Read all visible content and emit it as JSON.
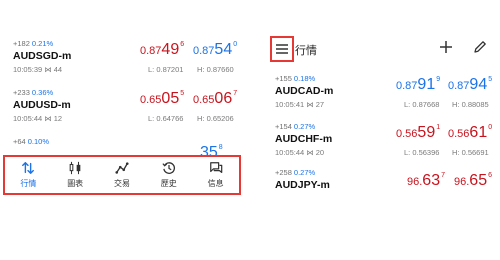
{
  "left": {
    "quotes": [
      {
        "change": "+182",
        "pct": "0.21%",
        "symbol": "AUDSGD-m",
        "time": "10:05:39",
        "spread": "44",
        "bid": {
          "small": "0.87",
          "big": "49",
          "sup": "6"
        },
        "ask": {
          "small": "0.87",
          "big": "54",
          "sup": "0"
        },
        "low": "L: 0.87201",
        "high": "H: 0.87660"
      },
      {
        "change": "+233",
        "pct": "0.36%",
        "symbol": "AUDUSD-m",
        "time": "10:05:44",
        "spread": "12",
        "bid": {
          "small": "0.65",
          "big": "05",
          "sup": "5"
        },
        "ask": {
          "small": "0.65",
          "big": "06",
          "sup": "7"
        },
        "low": "L: 0.64766",
        "high": "H: 0.65206"
      },
      {
        "change": "+64",
        "pct": "0.10%",
        "ask_partial": {
          "big": "35",
          "sup": "8"
        }
      }
    ],
    "bottom_nav": [
      {
        "label": "行情",
        "icon": "quotes-icon",
        "active": true
      },
      {
        "label": "圖表",
        "icon": "chart-icon",
        "active": false
      },
      {
        "label": "交易",
        "icon": "trade-icon",
        "active": false
      },
      {
        "label": "歷史",
        "icon": "history-icon",
        "active": false
      },
      {
        "label": "信息",
        "icon": "messages-icon",
        "active": false
      }
    ]
  },
  "right": {
    "header": {
      "title": "行情",
      "menu_icon": "hamburger-icon",
      "add_icon": "plus-icon",
      "edit_icon": "pencil-icon"
    },
    "quotes": [
      {
        "change": "+155",
        "pct": "0.18%",
        "symbol": "AUDCAD-m",
        "time": "10:05:41",
        "spread": "27",
        "bid": {
          "small": "0.87",
          "big": "91",
          "sup": "9",
          "color": "blue"
        },
        "ask": {
          "small": "0.87",
          "big": "94",
          "sup": "5",
          "color": "blue"
        },
        "low": "L: 0.87668",
        "high": "H: 0.88085"
      },
      {
        "change": "+154",
        "pct": "0.27%",
        "symbol": "AUDCHF-m",
        "time": "10:05:44",
        "spread": "20",
        "bid": {
          "small": "0.56",
          "big": "59",
          "sup": "1",
          "color": "red"
        },
        "ask": {
          "small": "0.56",
          "big": "61",
          "sup": "0",
          "color": "red"
        },
        "low": "L: 0.56396",
        "high": "H: 0.56691"
      },
      {
        "change": "+258",
        "pct": "0.27%",
        "symbol": "AUDJPY-m",
        "bid": {
          "small": "96.",
          "big": "63",
          "sup": "7",
          "color": "red"
        },
        "ask": {
          "small": "96.",
          "big": "65",
          "sup": "6",
          "color": "red"
        }
      }
    ]
  },
  "colors": {
    "red": "#c8141e",
    "blue": "#1a73e8",
    "highlight": "#e53935"
  }
}
